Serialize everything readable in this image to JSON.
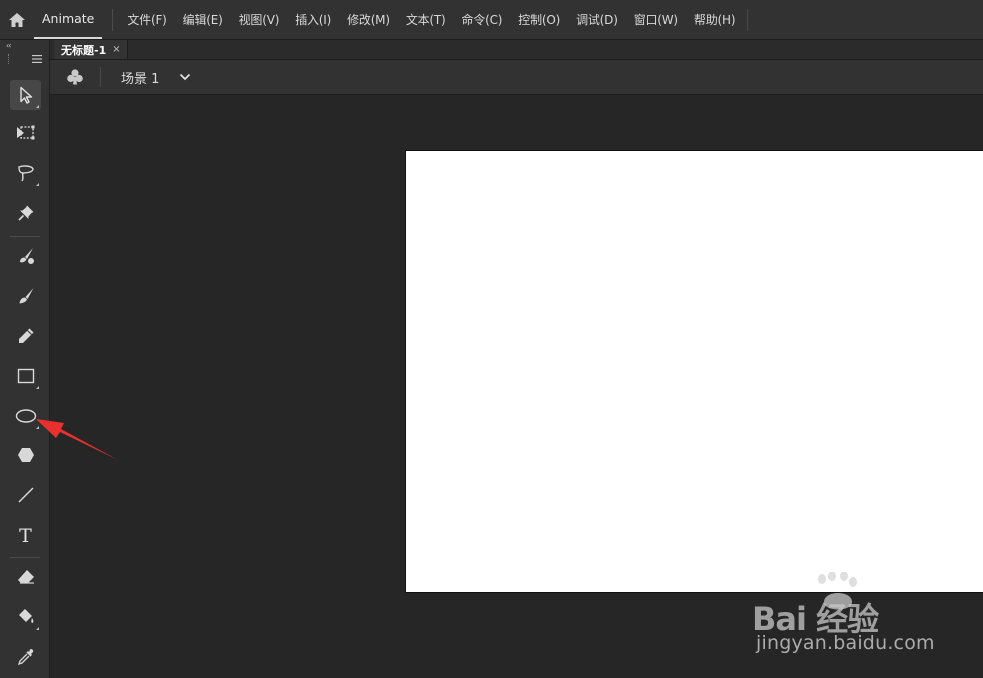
{
  "app": {
    "name": "Animate"
  },
  "menu": {
    "items": [
      "文件(F)",
      "编辑(E)",
      "视图(V)",
      "插入(I)",
      "修改(M)",
      "文本(T)",
      "命令(C)",
      "控制(O)",
      "调试(D)",
      "窗口(W)",
      "帮助(H)"
    ]
  },
  "document": {
    "tab_title": "无标题-1",
    "tab_close": "×"
  },
  "scene": {
    "label": "场景 1"
  },
  "toolbar": {
    "collapse_glyph": "‹‹",
    "tools": [
      {
        "name": "selection-tool",
        "icon": "selection-arrow-icon"
      },
      {
        "name": "free-transform-tool",
        "icon": "free-transform-icon"
      },
      {
        "name": "lasso-tool",
        "icon": "lasso-icon"
      },
      {
        "name": "asset-warp-tool",
        "icon": "pin-icon"
      },
      {
        "name": "paint-brush-tool",
        "icon": "paint-brush-icon"
      },
      {
        "name": "brush-tool",
        "icon": "brush-icon"
      },
      {
        "name": "pencil-tool",
        "icon": "pencil-icon"
      },
      {
        "name": "rectangle-tool",
        "icon": "rectangle-icon"
      },
      {
        "name": "oval-tool",
        "icon": "oval-icon"
      },
      {
        "name": "polystar-tool",
        "icon": "hexagon-icon"
      },
      {
        "name": "line-tool",
        "icon": "line-icon"
      },
      {
        "name": "text-tool",
        "icon": "text-t-icon",
        "glyph": "T"
      },
      {
        "name": "eraser-tool",
        "icon": "eraser-icon"
      },
      {
        "name": "paint-bucket-tool",
        "icon": "paint-bucket-icon"
      },
      {
        "name": "eyedropper-tool",
        "icon": "eyedropper-icon"
      }
    ]
  },
  "annotation": {
    "color": "#e8312f"
  },
  "watermark": {
    "brand": "Bai  经验",
    "url": "jingyan.baidu.com"
  },
  "colors": {
    "menubar": "#323232",
    "pasteboard": "#262626",
    "stage": "#ffffff"
  }
}
